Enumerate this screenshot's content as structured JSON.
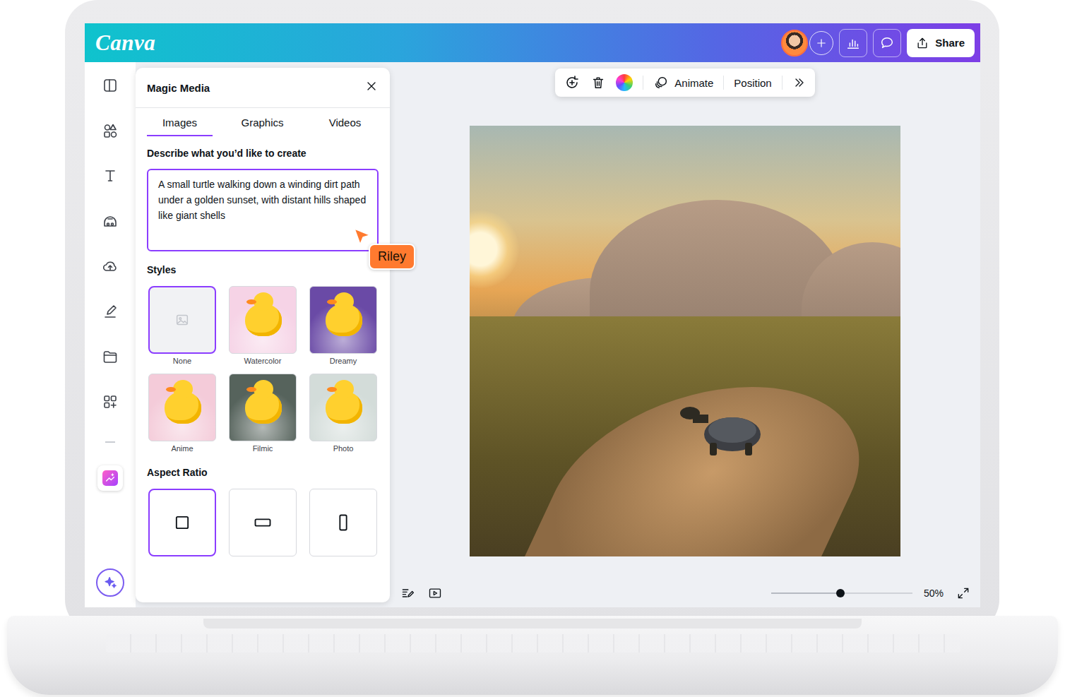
{
  "app": {
    "logo": "Canva"
  },
  "topbar": {
    "share": "Share"
  },
  "rail": {
    "items": [
      {
        "kind": "layout",
        "selected": false
      },
      {
        "kind": "elements",
        "selected": false
      },
      {
        "kind": "text",
        "selected": false
      },
      {
        "kind": "brand",
        "selected": false
      },
      {
        "kind": "uploads",
        "selected": false
      },
      {
        "kind": "draw",
        "selected": false
      },
      {
        "kind": "projects",
        "selected": false
      },
      {
        "kind": "apps",
        "selected": false
      },
      {
        "kind": "magic-media",
        "selected": true
      }
    ]
  },
  "panel": {
    "title": "Magic Media",
    "tabs": [
      {
        "label": "Images",
        "selected": true
      },
      {
        "label": "Graphics",
        "selected": false
      },
      {
        "label": "Videos",
        "selected": false
      }
    ],
    "prompt_label": "Describe what you’d like to create",
    "prompt": "A small turtle walking down a winding dirt path under a golden sunset, with distant hills shaped like giant shells",
    "styles_label": "Styles",
    "styles": [
      {
        "label": "None",
        "selected": true,
        "kind": "blank",
        "color": "#f1f2f4"
      },
      {
        "label": "Watercolor",
        "selected": false,
        "kind": "picture",
        "color": "#f6d3e6"
      },
      {
        "label": "Dreamy",
        "selected": false,
        "kind": "picture",
        "color": "#6a4aa6"
      },
      {
        "label": "Anime",
        "selected": false,
        "kind": "picture",
        "color": "#f4cbd9"
      },
      {
        "label": "Filmic",
        "selected": false,
        "kind": "picture",
        "color": "#56635c"
      },
      {
        "label": "Photo",
        "selected": false,
        "kind": "picture",
        "color": "#d3dcd9"
      }
    ],
    "aspect_label": "Aspect Ratio",
    "aspect_ratios": [
      {
        "kind": "square",
        "selected": true
      },
      {
        "kind": "landscape",
        "selected": false
      },
      {
        "kind": "portrait",
        "selected": false
      }
    ]
  },
  "cursor": {
    "name": "Riley"
  },
  "toolbar": {
    "animate": "Animate",
    "position": "Position"
  },
  "zoom": {
    "level": 0.49,
    "reading": "50%"
  }
}
